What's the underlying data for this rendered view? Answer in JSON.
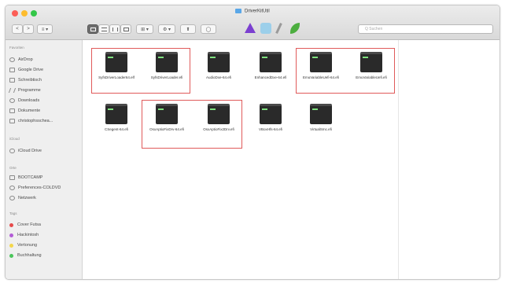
{
  "window": {
    "title": "DriverKitUtil"
  },
  "toolbar": {
    "back": "<",
    "forward": ">",
    "path_menu": "≡ ▾",
    "arrange": "⊞ ▾",
    "action": "⚙ ▾",
    "share": "⬆",
    "tag": "◯",
    "search_placeholder": "Q Suchen"
  },
  "sidebar": {
    "favorites_header": "Favoriten",
    "favorites": [
      "AirDrop",
      "Google Drive",
      "Schreibtisch",
      "Programme",
      "Downloads",
      "Dokumente",
      "christophsschea..."
    ],
    "icloud_header": "iCloud",
    "icloud": [
      "iCloud Drive"
    ],
    "locations_header": "Orte",
    "locations": [
      "BOOTCAMP",
      "Preferences-COLDVD",
      "Netzwerk"
    ],
    "tags_header": "Tags",
    "tags": [
      {
        "label": "Cover Futsa",
        "color": "#e64a4a"
      },
      {
        "label": "Hackintosh",
        "color": "#b25cd6"
      },
      {
        "label": "Vertonung",
        "color": "#f3d64a"
      },
      {
        "label": "Buchhaltung",
        "color": "#4ac55a"
      }
    ]
  },
  "files": [
    {
      "name": "SyfsDriverLoader64.elf"
    },
    {
      "name": "SyfsDriverLoader.efi"
    },
    {
      "name": "AudioDxe-64.efi"
    },
    {
      "name": "EnhancedDxe-64.efi"
    },
    {
      "name": "EmuVariableUefi-64.efi"
    },
    {
      "name": "EmuVariableUefi.efi"
    },
    {
      "name": "CSegent-64.efi"
    },
    {
      "name": "OsxAptioFixDrv-64.efi"
    },
    {
      "name": "OsxAptioFix2Drv.efi"
    },
    {
      "name": "VBoxHfs-64.efi"
    },
    {
      "name": "VirtualSmc.efi"
    }
  ]
}
